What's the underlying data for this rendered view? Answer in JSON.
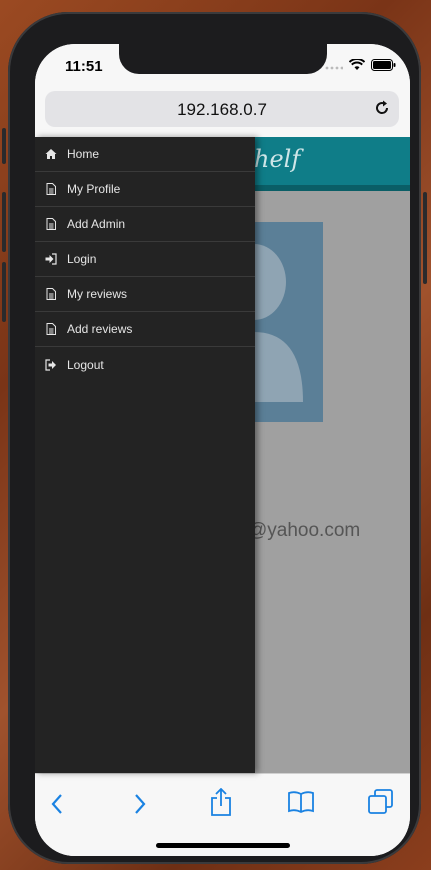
{
  "status": {
    "time": "11:51"
  },
  "browser": {
    "url": "192.168.0.7"
  },
  "page": {
    "brand": "helf",
    "email": "@yahoo.com"
  },
  "menu": {
    "items": [
      {
        "label": "Home",
        "icon": "home-icon"
      },
      {
        "label": "My Profile",
        "icon": "document-icon"
      },
      {
        "label": "Add Admin",
        "icon": "document-icon"
      },
      {
        "label": "Login",
        "icon": "sign-in-icon"
      },
      {
        "label": "My reviews",
        "icon": "document-icon"
      },
      {
        "label": "Add reviews",
        "icon": "document-icon"
      },
      {
        "label": "Logout",
        "icon": "sign-out-icon"
      }
    ]
  },
  "colors": {
    "accent": "#0f7d88",
    "drawer": "#232323",
    "ios_blue": "#1a82e2"
  }
}
